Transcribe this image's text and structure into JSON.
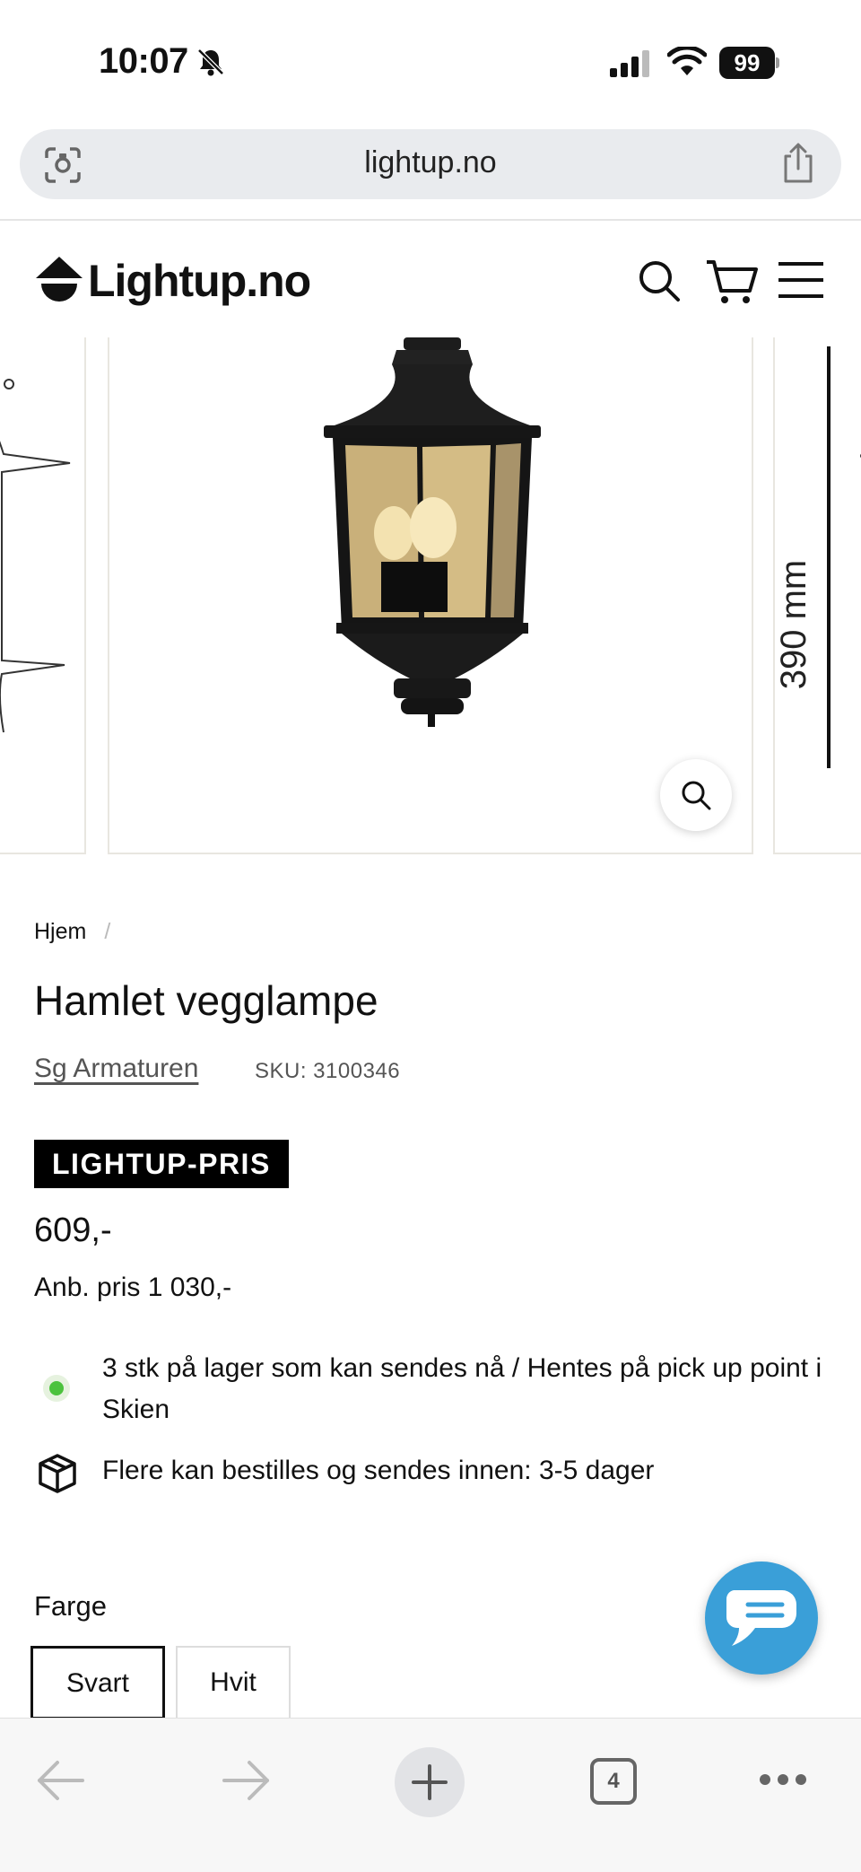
{
  "status_bar": {
    "time": "10:07",
    "battery": "99"
  },
  "browser": {
    "url": "lightup.no",
    "open_tabs": "4"
  },
  "site": {
    "logo_text": "Lightup.no"
  },
  "gallery": {
    "dimension_label": "390 mm"
  },
  "product": {
    "breadcrumb": [
      "Hjem",
      "/"
    ],
    "title": "Hamlet vegglampe",
    "brand": "Sg Armaturen",
    "sku": "SKU: 3100346",
    "price_badge": "LIGHTUP-PRIS",
    "price": "609,-",
    "recommended_price": "Anb. pris 1 030,-",
    "stock": "3 stk på lager som kan sendes nå / Hentes på pick up point i Skien",
    "delivery": "Flere kan bestilles og sendes innen: 3-5 dager",
    "color_label": "Farge",
    "color_options": [
      "Svart",
      "Hvit"
    ],
    "selected_color": "Svart"
  },
  "colors": {
    "accent_chat": "#3a9fd8",
    "in_stock": "#4cc23e",
    "badge_bg": "#000000"
  }
}
